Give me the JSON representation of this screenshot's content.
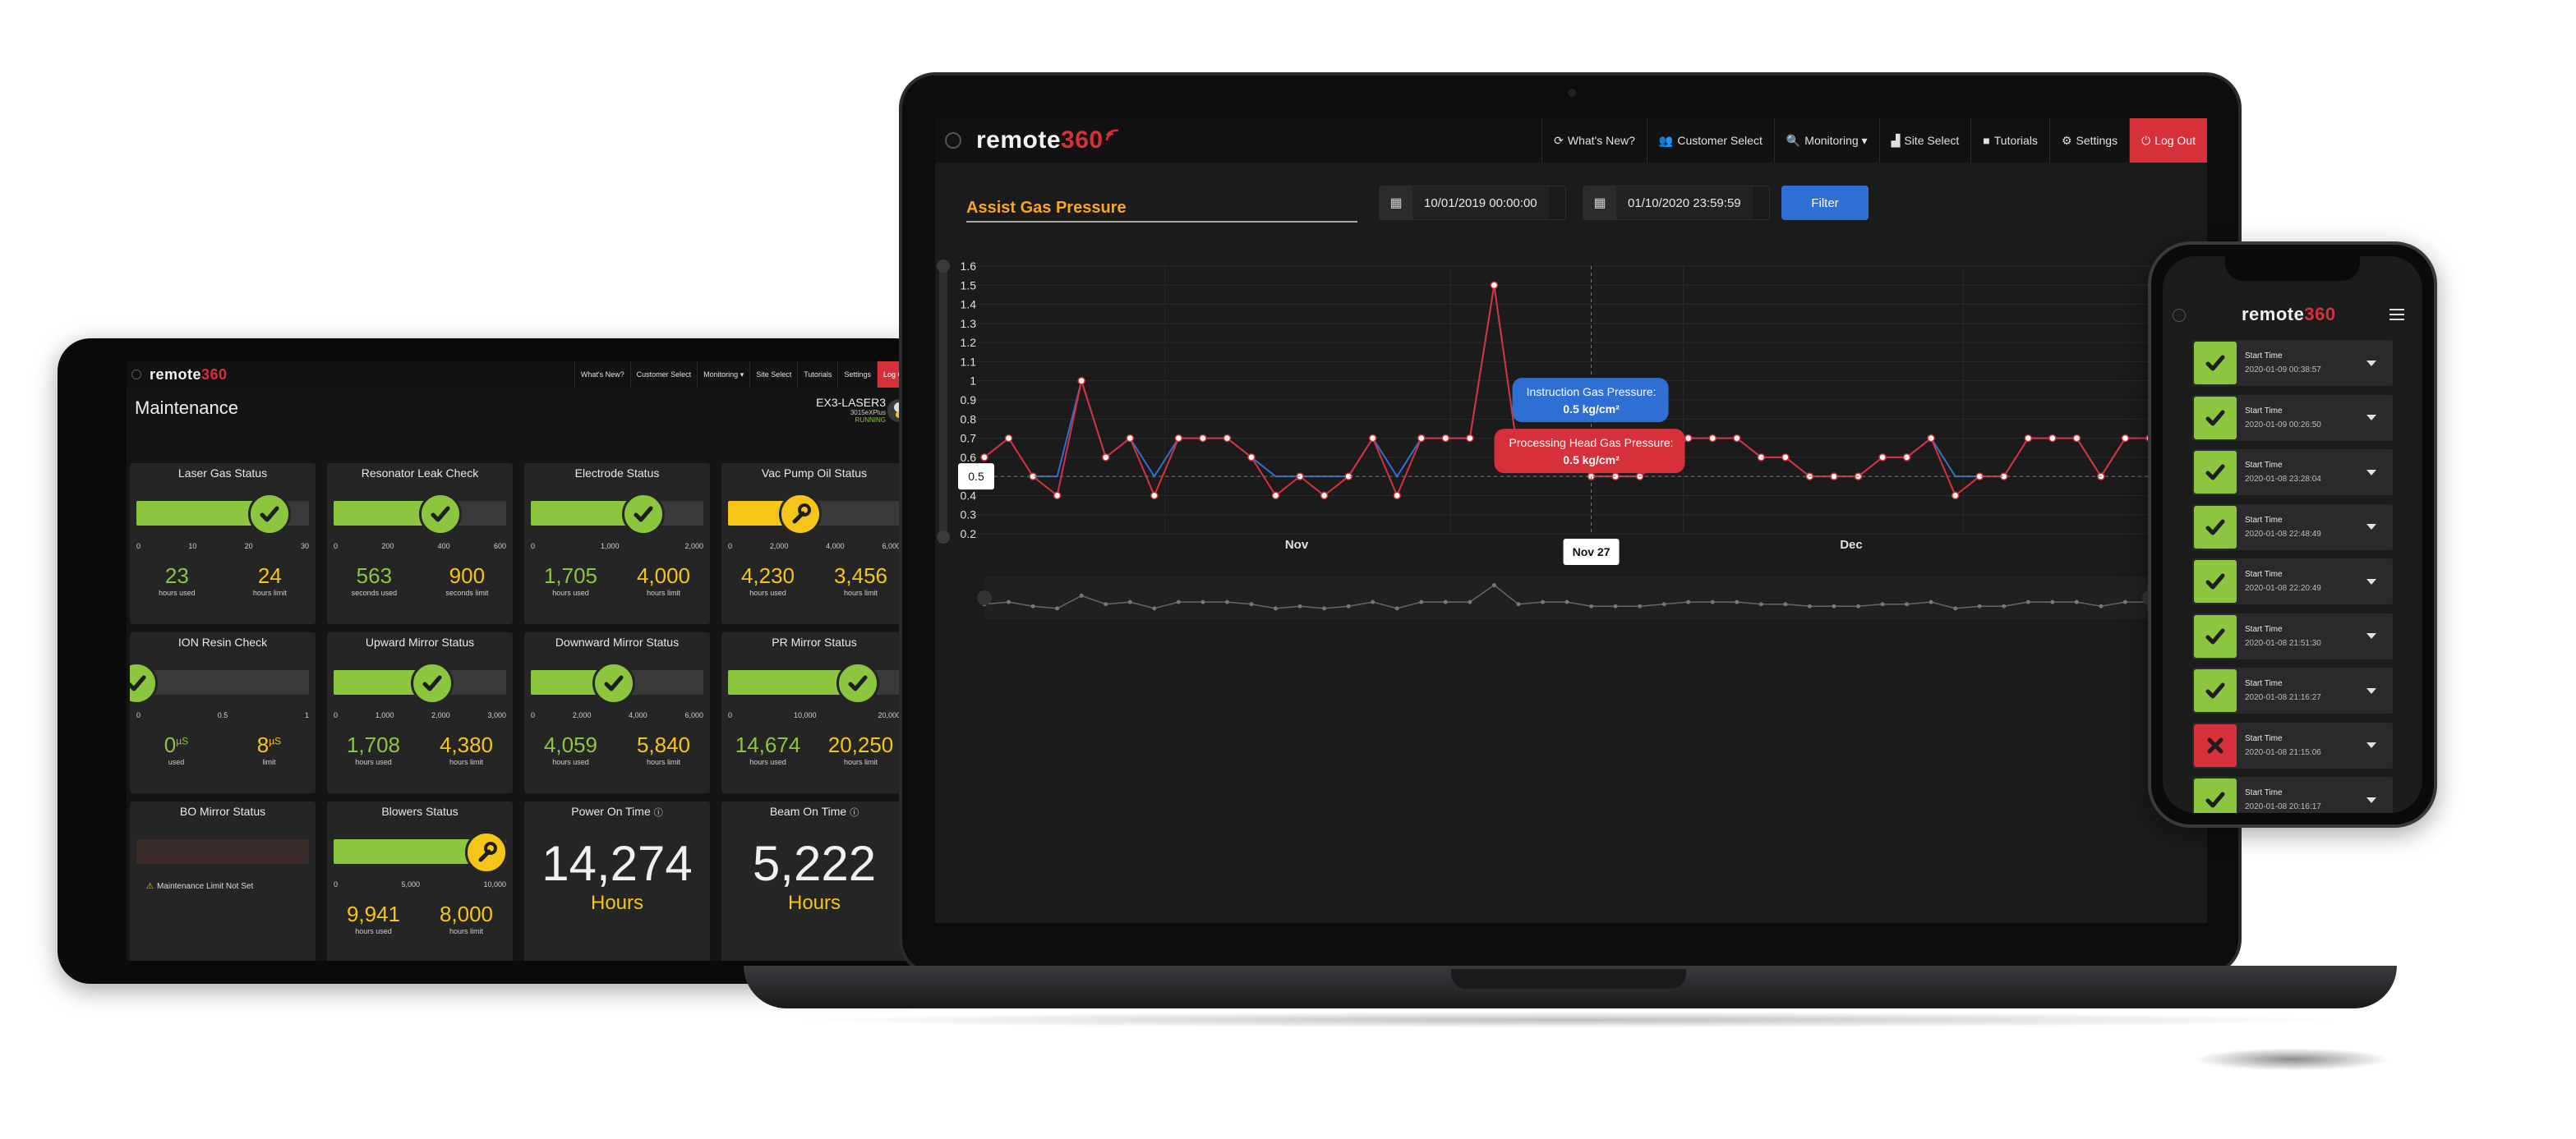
{
  "colors": {
    "green": "#8cc63f",
    "yellow": "#f5c518",
    "red": "#d6303a",
    "blue": "#2f6fd3",
    "orange": "#f5a623"
  },
  "laptop": {
    "brand": {
      "text": "remote",
      "num": "360"
    },
    "nav": [
      {
        "icon": "refresh-icon",
        "label": "What's New?"
      },
      {
        "icon": "users-icon",
        "label": "Customer Select"
      },
      {
        "icon": "search-icon",
        "label": "Monitoring ▾"
      },
      {
        "icon": "site-icon",
        "label": "Site Select"
      },
      {
        "icon": "video-icon",
        "label": "Tutorials"
      },
      {
        "icon": "gears-icon",
        "label": "Settings"
      },
      {
        "icon": "power-icon",
        "label": "Log Out"
      }
    ],
    "page_title": "Assist Gas Pressure",
    "start_date": "10/01/2019 00:00:00",
    "end_date": "01/10/2020 23:59:59",
    "filter_label": "Filter",
    "tooltip_blue": {
      "title": "Instruction Gas Pressure:",
      "value": "0.5 kg/cm²"
    },
    "tooltip_red": {
      "title": "Processing Head Gas Pressure:",
      "value": "0.5 kg/cm²"
    },
    "crosshair_y": "0.5",
    "crosshair_x": "Nov 27"
  },
  "chart_data": {
    "type": "line",
    "y_ticks": [
      "0.2",
      "0.3",
      "0.4",
      "0.5",
      "0.6",
      "0.7",
      "0.8",
      "0.9",
      "1",
      "1.1",
      "1.2",
      "1.3",
      "1.4",
      "1.5",
      "1.6"
    ],
    "x_ticks": [
      "Nov",
      "Dec"
    ],
    "ylim": [
      0.2,
      1.6
    ],
    "grid": true,
    "series": [
      {
        "name": "Processing Head Gas Pressure",
        "color": "#d6303a",
        "values": [
          0.6,
          0.7,
          0.5,
          0.4,
          1.0,
          0.6,
          0.7,
          0.4,
          0.7,
          0.7,
          0.7,
          0.6,
          0.4,
          0.5,
          0.4,
          0.5,
          0.7,
          0.4,
          0.7,
          0.7,
          0.7,
          1.5,
          0.6,
          0.7,
          0.7,
          0.5,
          0.5,
          0.5,
          0.6,
          0.7,
          0.7,
          0.7,
          0.6,
          0.6,
          0.5,
          0.5,
          0.5,
          0.6,
          0.6,
          0.7,
          0.4,
          0.5,
          0.5,
          0.7,
          0.7,
          0.7,
          0.5,
          0.7,
          0.7
        ]
      },
      {
        "name": "Instruction Gas Pressure",
        "color": "#2f6fd3",
        "values": [
          0.6,
          0.7,
          0.5,
          0.5,
          1.0,
          0.6,
          0.7,
          0.5,
          0.7,
          0.7,
          0.7,
          0.6,
          0.5,
          0.5,
          0.5,
          0.5,
          0.7,
          0.5,
          0.7,
          0.7,
          0.7,
          1.5,
          0.6,
          0.7,
          0.7,
          0.5,
          0.5,
          0.5,
          0.6,
          0.7,
          0.7,
          0.7,
          0.6,
          0.6,
          0.5,
          0.5,
          0.5,
          0.6,
          0.6,
          0.7,
          0.5,
          0.5,
          0.5,
          0.7,
          0.7,
          0.7,
          0.5,
          0.7,
          0.7
        ]
      }
    ]
  },
  "tablet": {
    "brand": {
      "text": "remote",
      "num": "360"
    },
    "nav": [
      "What's New?",
      "Customer Select",
      "Monitoring ▾",
      "Site Select",
      "Tutorials",
      "Settings",
      "Log Out"
    ],
    "page_title": "Maintenance",
    "machine": {
      "name": "EX3-LASER3",
      "model": "3015eXPlus",
      "state": "RUNNING"
    },
    "cards": [
      {
        "title": "Laser Gas Status",
        "status": "ok",
        "fill": 0.77,
        "color": "green",
        "ticks": [
          "0",
          "10",
          "20",
          "30"
        ],
        "used": "23",
        "used_label": "hours used",
        "limit": "24",
        "limit_label": "hours limit"
      },
      {
        "title": "Resonator Leak Check",
        "status": "ok",
        "fill": 0.62,
        "color": "green",
        "ticks": [
          "0",
          "200",
          "400",
          "600"
        ],
        "used": "563",
        "used_label": "seconds used",
        "limit": "900",
        "limit_label": "seconds limit"
      },
      {
        "title": "Electrode Status",
        "status": "ok",
        "fill": 0.65,
        "color": "green",
        "ticks": [
          "0",
          "1,000",
          "2,000"
        ],
        "used": "1,705",
        "used_label": "hours used",
        "limit": "4,000",
        "limit_label": "hours limit"
      },
      {
        "title": "Vac Pump Oil Status",
        "status": "warn",
        "fill": 0.42,
        "color": "yellow",
        "ticks": [
          "0",
          "2,000",
          "4,000",
          "6,000"
        ],
        "used": "4,230",
        "used_label": "hours used",
        "limit": "3,456",
        "limit_label": "hours limit"
      },
      {
        "title": "ION Resin Check",
        "status": "ok",
        "fill": 0.0,
        "color": "green",
        "ticks": [
          "0",
          "0.5",
          "1"
        ],
        "used": "0",
        "used_unit": "µS",
        "used_label": "used",
        "limit": "8",
        "limit_unit": "µS",
        "limit_label": "limit"
      },
      {
        "title": "Upward Mirror Status",
        "status": "ok",
        "fill": 0.57,
        "color": "green",
        "ticks": [
          "0",
          "1,000",
          "2,000",
          "3,000"
        ],
        "used": "1,708",
        "used_label": "hours used",
        "limit": "4,380",
        "limit_label": "hours limit"
      },
      {
        "title": "Downward Mirror Status",
        "status": "ok",
        "fill": 0.48,
        "color": "green",
        "ticks": [
          "0",
          "2,000",
          "4,000",
          "6,000"
        ],
        "used": "4,059",
        "used_label": "hours used",
        "limit": "5,840",
        "limit_label": "hours limit"
      },
      {
        "title": "PR Mirror Status",
        "status": "ok",
        "fill": 0.75,
        "color": "green",
        "ticks": [
          "0",
          "10,000",
          "20,000"
        ],
        "used": "14,674",
        "used_label": "hours used",
        "limit": "20,250",
        "limit_label": "hours limit"
      }
    ],
    "bo_mirror": {
      "title": "BO Mirror Status",
      "note": "Maintenance Limit Not Set"
    },
    "blowers": {
      "title": "Blowers Status",
      "status": "warn",
      "fill": 0.98,
      "ticks": [
        "0",
        "5,000",
        "10,000"
      ],
      "used": "9,941",
      "used_label": "hours used",
      "limit": "8,000",
      "limit_label": "hours limit"
    },
    "power_on": {
      "title": "Power On Time",
      "value": "14,274",
      "unit": "Hours"
    },
    "beam_on": {
      "title": "Beam On Time",
      "value": "5,222",
      "unit": "Hours"
    }
  },
  "phone": {
    "brand": {
      "text": "remote",
      "num": "360"
    },
    "rows": [
      {
        "label": "Start Time",
        "date": "2020-01-09 00:38:57",
        "status": "ok"
      },
      {
        "label": "Start Time",
        "date": "2020-01-09 00:26:50",
        "status": "ok"
      },
      {
        "label": "Start Time",
        "date": "2020-01-08 23:28:04",
        "status": "ok"
      },
      {
        "label": "Start Time",
        "date": "2020-01-08 22:48:49",
        "status": "ok"
      },
      {
        "label": "Start Time",
        "date": "2020-01-08 22:20:49",
        "status": "ok"
      },
      {
        "label": "Start Time",
        "date": "2020-01-08 21:51:30",
        "status": "ok"
      },
      {
        "label": "Start Time",
        "date": "2020-01-08 21:16:27",
        "status": "ok"
      },
      {
        "label": "Start Time",
        "date": "2020-01-08 21:15:06",
        "status": "fail"
      },
      {
        "label": "Start Time",
        "date": "2020-01-08 20:16:17",
        "status": "ok"
      }
    ]
  }
}
